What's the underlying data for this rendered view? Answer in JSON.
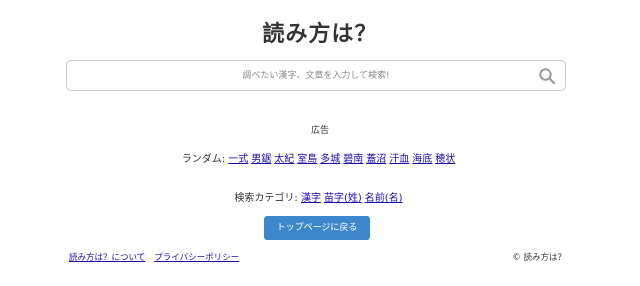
{
  "header": {
    "title": "読み方は？"
  },
  "search": {
    "placeholder": "調べたい漢字、文章を入力して検索!",
    "icon": "search-icon"
  },
  "ad": {
    "label": "広告"
  },
  "random": {
    "label": "ランダム: ",
    "links": [
      "一式",
      "男鋸",
      "太紀",
      "室島",
      "多城",
      "碧南",
      "蓋沼",
      "汗血",
      "海底",
      "穂状"
    ]
  },
  "category": {
    "label": "検索カテゴリ: ",
    "links": [
      "漢字",
      "苗字(姓)",
      "名前(名)"
    ]
  },
  "top_button": {
    "label": "トップページに戻る"
  },
  "footer": {
    "links": [
      "読み方は？について",
      "プライバシーポリシー"
    ],
    "copyright": "© 読み方は？"
  },
  "colors": {
    "link": "#1a0dab",
    "button_bg": "#3d88cc",
    "button_text": "#ffffff"
  }
}
